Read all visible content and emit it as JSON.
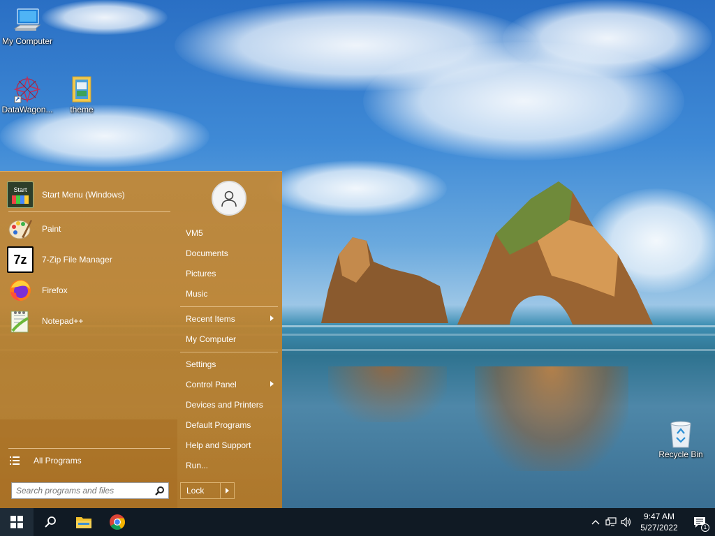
{
  "desktop": {
    "icons": [
      {
        "label": "My Computer",
        "icon": "computer-icon"
      },
      {
        "label": "DataWagon...",
        "icon": "datawagon-icon"
      },
      {
        "label": "theme",
        "icon": "folder-icon"
      },
      {
        "label": "Recycle Bin",
        "icon": "recycle-bin-icon"
      }
    ]
  },
  "start_menu": {
    "pinned": [
      {
        "label": "Start Menu (Windows)",
        "icon": "start-menu-icon",
        "icon_text": "Start"
      },
      {
        "label": "Paint",
        "icon": "paint-icon"
      },
      {
        "label": "7-Zip File Manager",
        "icon": "7zip-icon",
        "icon_text": "7z"
      },
      {
        "label": "Firefox",
        "icon": "firefox-icon"
      },
      {
        "label": "Notepad++",
        "icon": "notepadpp-icon"
      }
    ],
    "all_programs": "All Programs",
    "search_placeholder": "Search programs and files",
    "right_items": [
      {
        "label": "VM5"
      },
      {
        "label": "Documents"
      },
      {
        "label": "Pictures"
      },
      {
        "label": "Music"
      },
      {
        "label": "Recent Items",
        "submenu": true
      },
      {
        "label": "My Computer"
      },
      {
        "label": "Settings"
      },
      {
        "label": "Control Panel",
        "submenu": true
      },
      {
        "label": "Devices and Printers"
      },
      {
        "label": "Default Programs"
      },
      {
        "label": "Help and Support"
      },
      {
        "label": "Run..."
      }
    ],
    "lock_label": "Lock"
  },
  "taskbar": {
    "apps": [
      "start-icon",
      "search-icon",
      "file-explorer-icon",
      "chrome-icon"
    ],
    "time": "9:47 AM",
    "date": "5/27/2022",
    "notification_count": "1"
  }
}
